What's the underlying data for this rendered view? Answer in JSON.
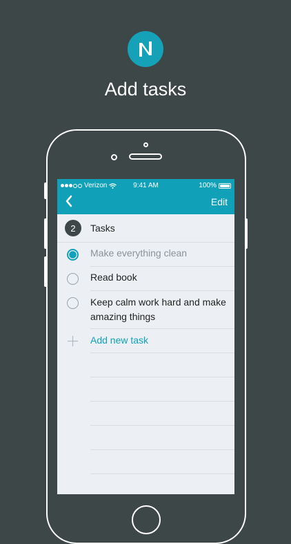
{
  "promo": {
    "headline": "Add tasks",
    "logo_icon": "n-logo-icon",
    "accent_color": "#15a2b8",
    "background_color": "#3e4747"
  },
  "status_bar": {
    "carrier": "Verizon",
    "time": "9:41 AM",
    "battery": "100%"
  },
  "nav": {
    "back_icon": "chevron-left-icon",
    "edit_label": "Edit",
    "color": "#10a1b9"
  },
  "list": {
    "count": "2",
    "title": "Tasks"
  },
  "tasks": [
    {
      "label": "Make everything clean",
      "done": true
    },
    {
      "label": "Read book",
      "done": false
    },
    {
      "label": "Keep calm work hard and make amazing things",
      "done": false
    }
  ],
  "add_task": {
    "label": "Add new task",
    "icon": "plus-icon"
  }
}
